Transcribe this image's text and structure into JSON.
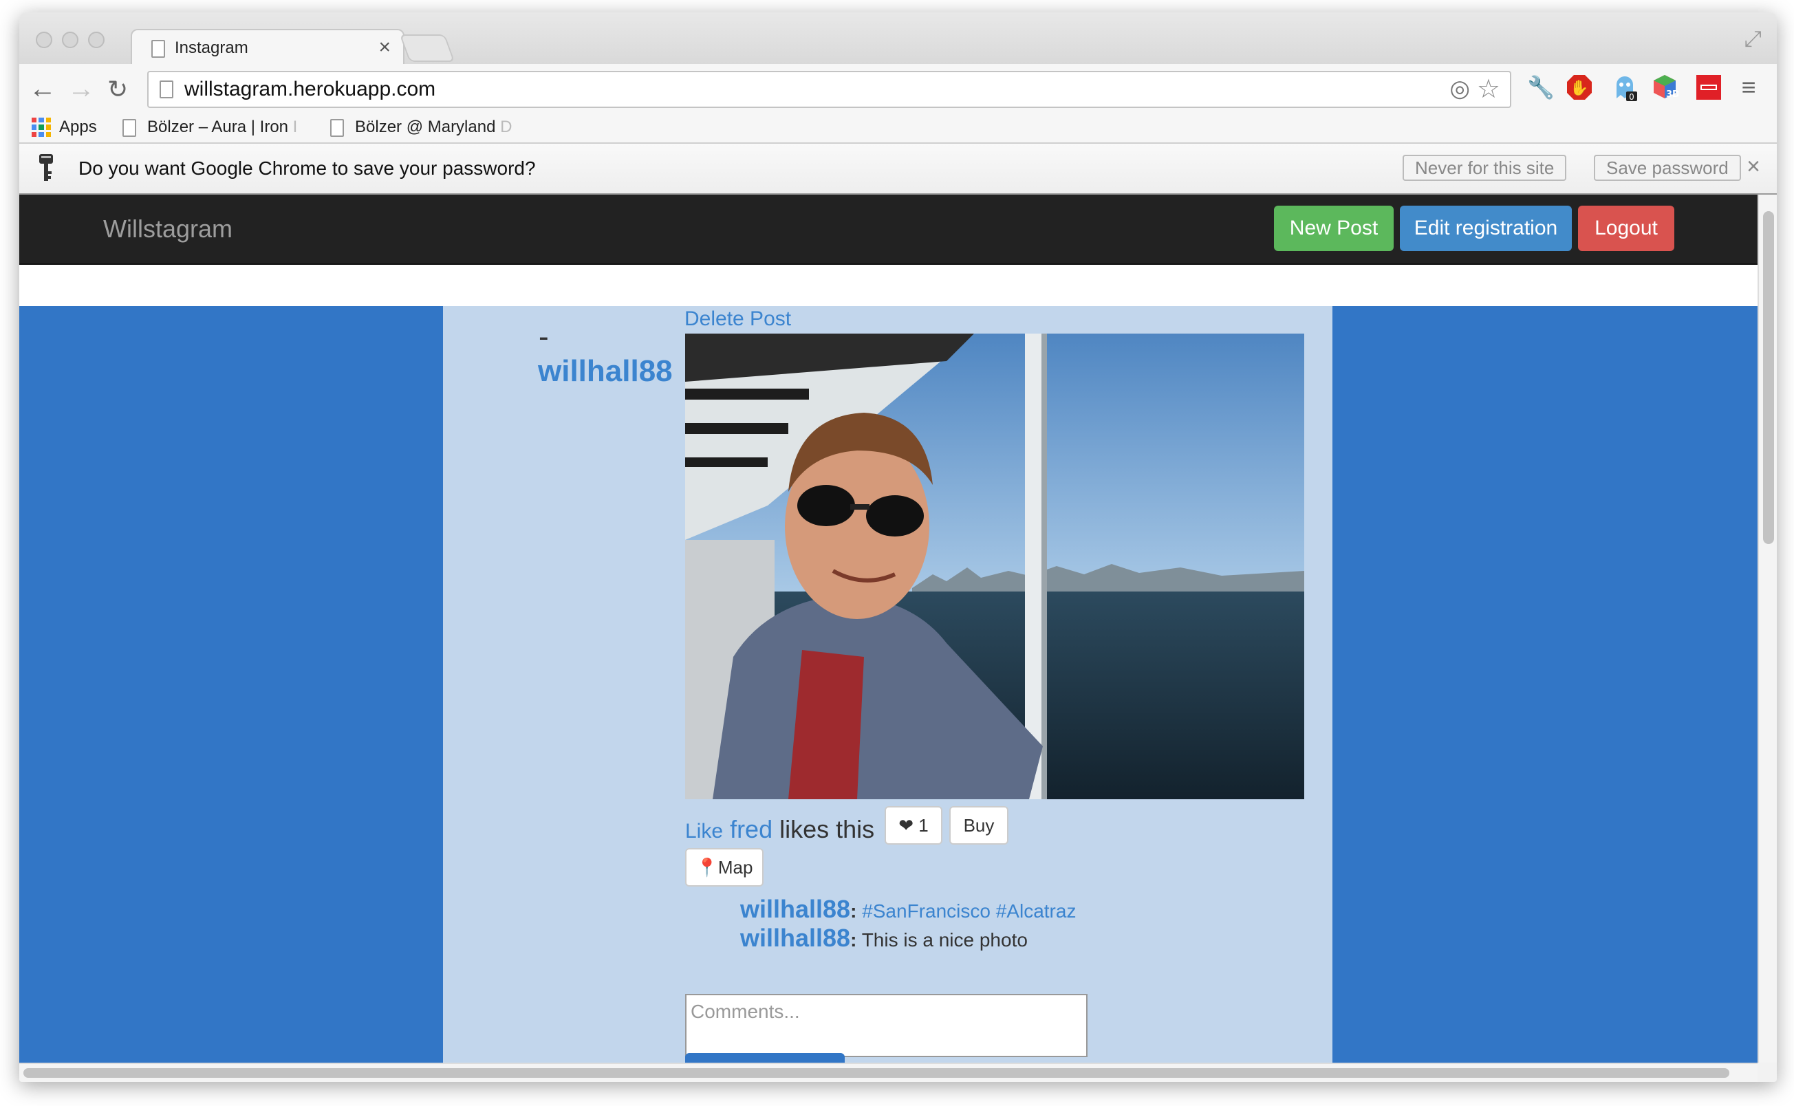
{
  "browser": {
    "tab_title": "Instagram",
    "tab_close": "×",
    "url": "willstagram.herokuapp.com",
    "bookmarks": {
      "apps": "Apps",
      "item1": "Bölzer – Aura | Iron",
      "item1_fade": " I",
      "item2": "Bölzer @ Maryland ",
      "item2_fade": "D"
    },
    "extensions": [
      "wrench-icon",
      "adblock-icon",
      "ghostery-icon",
      "3d-icon",
      "red-extension-icon",
      "menu-icon"
    ],
    "ext_badges": {
      "ghostery": "0",
      "three_d": "3D"
    }
  },
  "infobar": {
    "message": "Do you want Google Chrome to save your password?",
    "never_label": "Never for this site",
    "save_label": "Save password",
    "close": "×"
  },
  "site": {
    "brand": "Willstagram",
    "nav": {
      "new_post": "New Post",
      "edit_registration": "Edit registration",
      "logout": "Logout"
    },
    "colors": {
      "navbar": "#222222",
      "background": "#3276c6",
      "content": "#c2d6ec",
      "link": "#3b84cf",
      "success": "#5cb85c",
      "primary": "#428bca",
      "danger": "#d9534f"
    }
  },
  "post": {
    "dash": "-",
    "author": "willhall88",
    "delete_label": "Delete Post",
    "like_label": "Like",
    "liker": "fred",
    "likes_text": "likes this",
    "like_count": "1",
    "buy_label": "Buy",
    "map_label": "Map",
    "comments": [
      {
        "user": "willhall88",
        "sep": ":",
        "text": "#SanFrancisco #Alcatraz"
      },
      {
        "user": "willhall88",
        "sep": ":",
        "text": "This is a nice photo"
      }
    ],
    "comment_placeholder": "Comments..."
  }
}
